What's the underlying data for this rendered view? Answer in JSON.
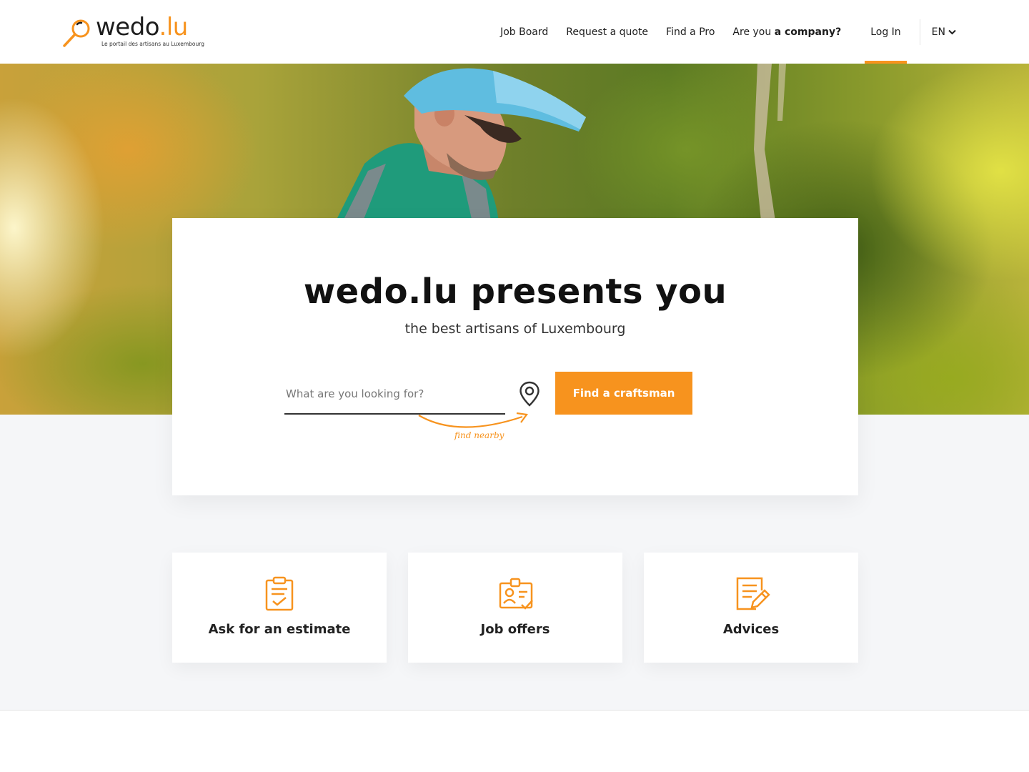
{
  "brand": {
    "name": "wedo",
    "tld": ".lu",
    "tagline": "Le portail des artisans au Luxembourg",
    "accent": "#f7931e"
  },
  "nav": {
    "items": [
      "Job Board",
      "Request a quote",
      "Find a Pro"
    ],
    "company_prefix": "Are you ",
    "company_bold": "a company?",
    "login": "Log In",
    "lang": "EN"
  },
  "hero": {
    "title": "wedo.lu presents you",
    "subtitle": "the best artisans of Luxembourg",
    "search_placeholder": "What are you looking for?",
    "search_button": "Find a craftsman",
    "find_nearby": "find nearby"
  },
  "cards": [
    {
      "label": "Ask for an estimate",
      "icon": "clipboard-check-icon"
    },
    {
      "label": "Job offers",
      "icon": "id-badge-check-icon"
    },
    {
      "label": "Advices",
      "icon": "document-edit-icon"
    }
  ]
}
